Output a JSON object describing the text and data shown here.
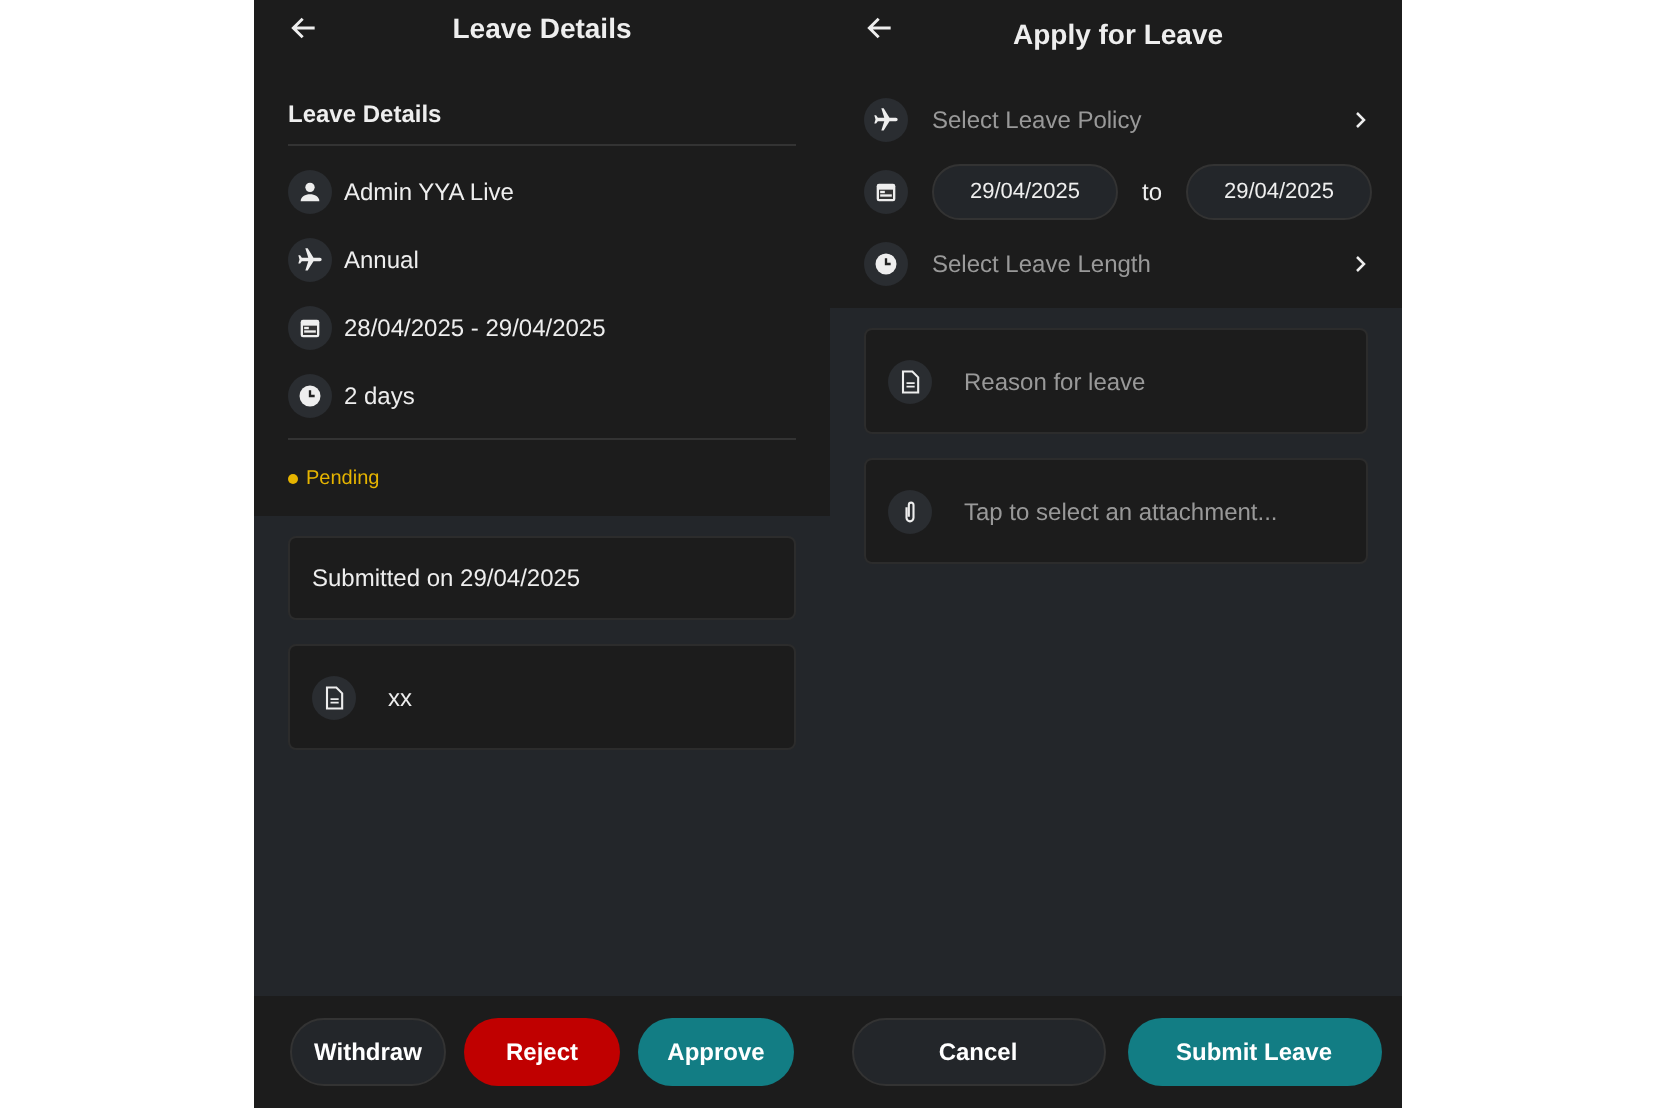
{
  "leave_details_screen": {
    "title": "Leave Details",
    "section_title": "Leave Details",
    "info_rows": [
      {
        "kind": "person",
        "text": "Admin YYA Live"
      },
      {
        "kind": "plane",
        "text": "Annual"
      },
      {
        "kind": "calendar",
        "text": "28/04/2025 - 29/04/2025"
      },
      {
        "kind": "clock",
        "text": "2 days"
      }
    ],
    "status": {
      "text": "Pending",
      "color": "#e6b400"
    },
    "submitted": "Submitted on 29/04/2025",
    "reason": "xx",
    "buttons": [
      {
        "label": "Withdraw",
        "kind": "outline"
      },
      {
        "label": "Reject",
        "kind": "danger"
      },
      {
        "label": "Approve",
        "kind": "primary"
      }
    ]
  },
  "apply_screen": {
    "title": "Apply for Leave",
    "policy_placeholder": "Select Leave Policy",
    "from_date": "29/04/2025",
    "to_label": "to",
    "to_date": "29/04/2025",
    "length_placeholder": "Select Leave Length",
    "reason_placeholder": "Reason for leave",
    "attachment_placeholder": "Tap to select an attachment...",
    "buttons": [
      {
        "label": "Cancel",
        "kind": "outline"
      },
      {
        "label": "Submit Leave",
        "kind": "primary"
      }
    ]
  }
}
